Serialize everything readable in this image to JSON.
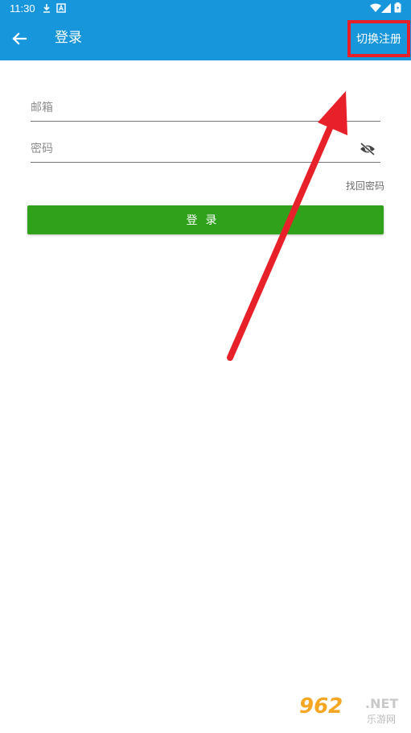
{
  "status_bar": {
    "time": "11:30",
    "icons": [
      "download-icon",
      "a-icon",
      "wifi-icon",
      "signal-icon",
      "battery-icon"
    ]
  },
  "app_bar": {
    "back_icon": "arrow-left-icon",
    "title": "登录",
    "switch_register_label": "切换注册"
  },
  "form": {
    "email_placeholder": "邮箱",
    "email_value": "",
    "password_placeholder": "密码",
    "password_value": "",
    "password_toggle_icon": "eye-off-icon",
    "forgot_password_label": "找回密码",
    "login_button_label": "登录"
  },
  "watermark": {
    "brand": "962",
    "suffix": ".NET",
    "subtitle": "乐游网"
  },
  "colors": {
    "app_bar": "#1796db",
    "login_button": "#2fa11b",
    "annotation": "#e8202a"
  }
}
